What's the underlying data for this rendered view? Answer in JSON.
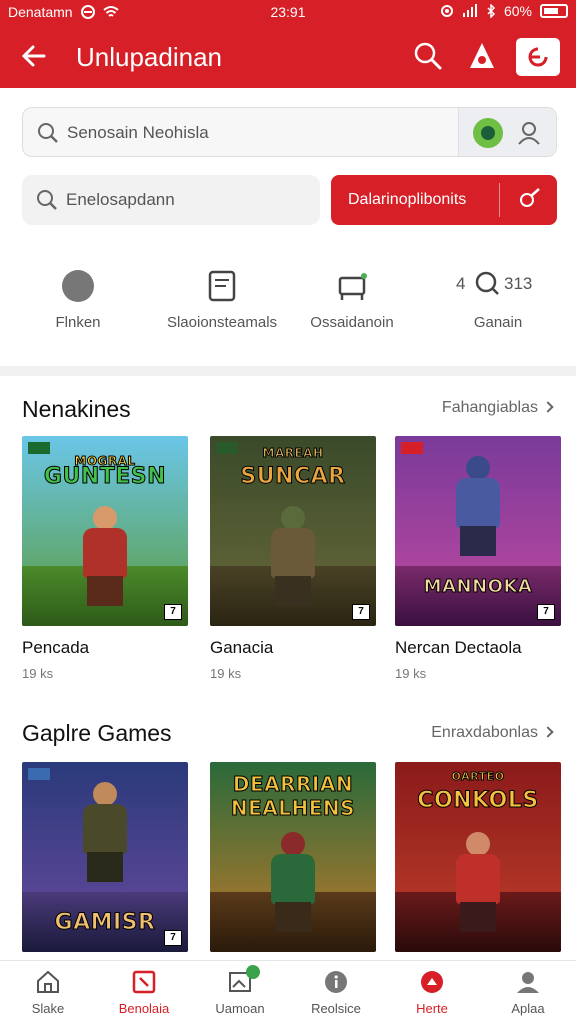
{
  "status_bar": {
    "left_text": "Denatamn",
    "time": "23:91",
    "battery": "60%"
  },
  "app_bar": {
    "title": "Unlupadinan"
  },
  "search_primary": {
    "placeholder": "Senosain Neohisla"
  },
  "search_secondary": {
    "placeholder": "Enelosapdann"
  },
  "red_button": {
    "label": "Dalarinoplibonits"
  },
  "shortcuts": [
    {
      "label": "Flnken"
    },
    {
      "label": "Slaoionsteamals"
    },
    {
      "label": "Ossaidanoin"
    },
    {
      "label": "Ganain",
      "value_left": "4",
      "value_right": "313"
    }
  ],
  "sections": [
    {
      "title": "Nenakines",
      "link": "Fahangiablas",
      "cards": [
        {
          "name": "Pencada",
          "meta": "19 ks",
          "banner": "GUNTESN",
          "banner_top": "MOGRAL"
        },
        {
          "name": "Ganacia",
          "meta": "19 ks",
          "banner": "SUNCAR",
          "banner_top": "MAREAH"
        },
        {
          "name": "Nercan Dectaola",
          "meta": "19 ks",
          "banner": "MANNOKA",
          "banner_top": ""
        }
      ]
    },
    {
      "title": "Gaplre Games",
      "link": "Enraxdabonlas",
      "cards": [
        {
          "name": "",
          "meta": "",
          "banner": "GAMISR",
          "banner_top": ""
        },
        {
          "name": "",
          "meta": "",
          "banner": "NEALHENS",
          "banner_top": "DEARRIAN"
        },
        {
          "name": "",
          "meta": "",
          "banner": "CONKOLS",
          "banner_top": "OARTEO"
        }
      ]
    }
  ],
  "bottom_nav": [
    {
      "label": "Slake",
      "icon": "home-icon"
    },
    {
      "label": "Benolaia",
      "icon": "bookmark-icon",
      "active": true
    },
    {
      "label": "Uamoan",
      "icon": "image-icon"
    },
    {
      "label": "Reolsice",
      "icon": "info-icon"
    },
    {
      "label": "Herte",
      "icon": "fire-icon",
      "active": true
    },
    {
      "label": "Aplaa",
      "icon": "user-icon"
    }
  ],
  "colors": {
    "accent": "#d61f26",
    "background": "#ffffff",
    "divider": "#f0f0f0"
  }
}
